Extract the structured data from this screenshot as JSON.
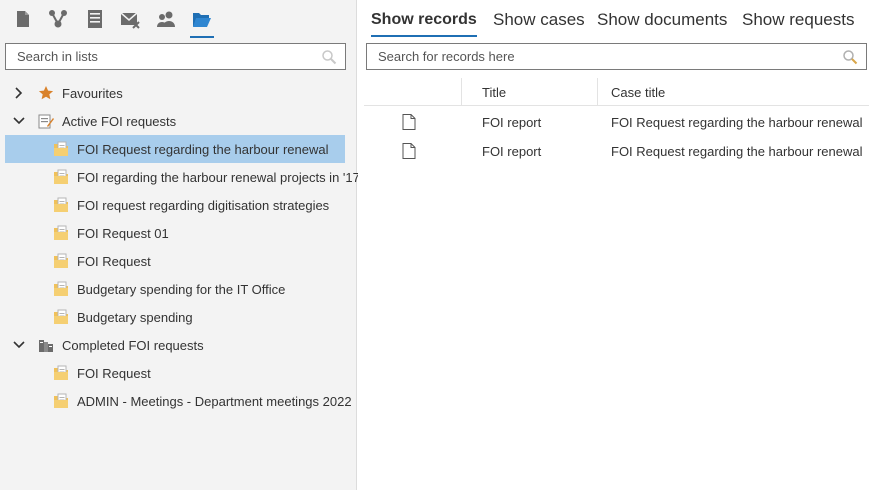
{
  "colors": {
    "accent": "#1f6fb4",
    "selected_row": "#a8cdec",
    "folder": "#f0c15a",
    "star": "#d9822b"
  },
  "toolbar": {
    "icons": [
      {
        "name": "document-icon",
        "active": false
      },
      {
        "name": "workflow-icon",
        "active": false
      },
      {
        "name": "register-icon",
        "active": false
      },
      {
        "name": "mail-icon",
        "active": false
      },
      {
        "name": "contacts-icon",
        "active": false
      },
      {
        "name": "folder-open-icon",
        "active": true
      }
    ]
  },
  "left_search": {
    "placeholder": "Search in lists",
    "icon": "search-icon"
  },
  "tree": {
    "favourites": {
      "label": "Favourites",
      "icon": "star-icon",
      "expanded": false
    },
    "active": {
      "label": "Active FOI requests",
      "icon": "edit-list-icon",
      "expanded": true,
      "items": [
        "FOI Request regarding the harbour renewal",
        "FOI regarding the harbour renewal projects in '17",
        "FOI request regarding digitisation strategies",
        "FOI Request 01",
        "FOI Request",
        "Budgetary spending for the IT Office",
        "Budgetary spending"
      ],
      "selected_index": 0
    },
    "completed": {
      "label": "Completed FOI requests",
      "icon": "archive-icon",
      "expanded": true,
      "items": [
        "FOI Request",
        "ADMIN - Meetings - Department meetings 2022"
      ]
    }
  },
  "tabs": [
    "Show records",
    "Show cases",
    "Show documents",
    "Show requests"
  ],
  "active_tab": 0,
  "right_search": {
    "placeholder": "Search for records here",
    "icon": "search-icon"
  },
  "grid": {
    "columns": [
      "Title",
      "Case title"
    ],
    "rows": [
      {
        "title": "FOI report",
        "case_title": "FOI Request regarding the harbour renewal",
        "icon": "document-icon"
      },
      {
        "title": "FOI report",
        "case_title": "FOI Request regarding the harbour renewal",
        "icon": "document-icon"
      }
    ]
  }
}
